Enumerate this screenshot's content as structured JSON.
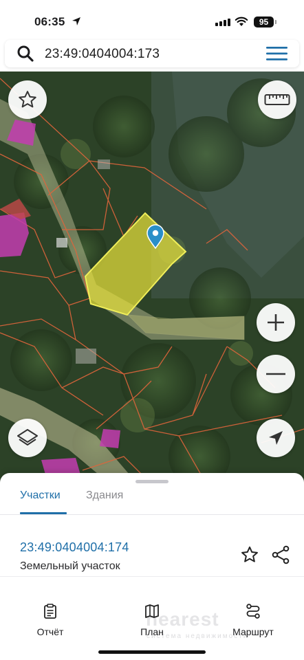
{
  "status_bar": {
    "time": "06:35",
    "battery": "95"
  },
  "search": {
    "query": "23:49:0404004:173"
  },
  "map": {
    "selected_parcel_color": "#e6e13c",
    "parcel_border_color": "#e0653c",
    "marker_color": "#2a8fc8",
    "buttons": [
      "favorite-star-icon",
      "ruler-icon",
      "zoom-in-icon",
      "zoom-out-icon",
      "layers-icon",
      "navigation-arrow-icon"
    ]
  },
  "sheet": {
    "tabs": [
      {
        "label": "Участки",
        "active": true
      },
      {
        "label": "Здания",
        "active": false
      }
    ],
    "item": {
      "number": "23:49:0404004:174",
      "type": "Земельный участок"
    }
  },
  "bottom_nav": {
    "items": [
      {
        "label": "Отчёт",
        "icon": "report-icon"
      },
      {
        "label": "План",
        "icon": "map-plan-icon"
      },
      {
        "label": "Маршрут",
        "icon": "route-icon"
      }
    ]
  },
  "watermark": {
    "brand": "nearest",
    "tagline": "система недвижимости"
  },
  "colors": {
    "accent": "#1f6fa8"
  }
}
